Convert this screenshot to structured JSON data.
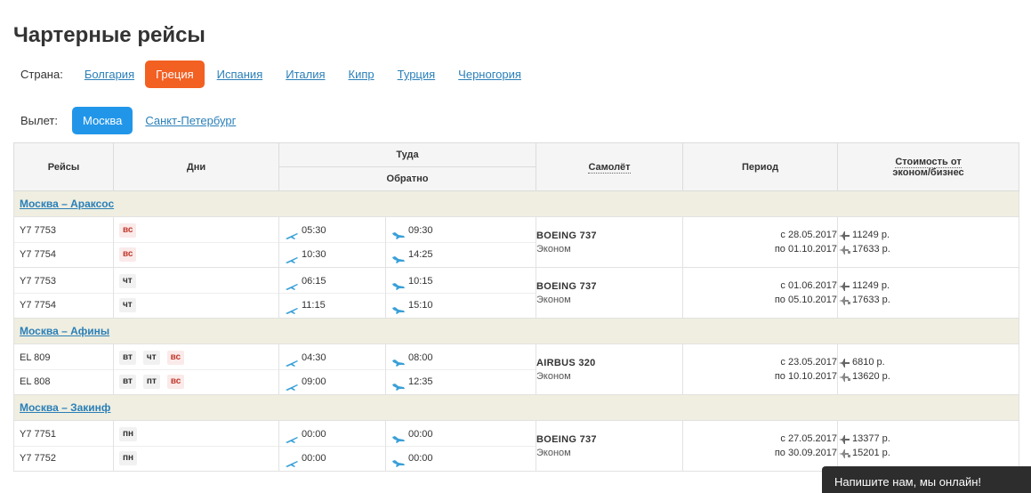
{
  "page": {
    "title": "Чартерные рейсы"
  },
  "country_filter": {
    "label": "Страна:",
    "options": [
      "Болгария",
      "Греция",
      "Испания",
      "Италия",
      "Кипр",
      "Турция",
      "Черногория"
    ],
    "selected": "Греция"
  },
  "departure_filter": {
    "label": "Вылет:",
    "options": [
      "Москва",
      "Санкт-Петербург"
    ],
    "selected": "Москва"
  },
  "table": {
    "headers": {
      "flights": "Рейсы",
      "days": "Дни",
      "there": "Туда",
      "back": "Обратно",
      "plane": "Самолёт",
      "period": "Период",
      "cost_line1": "Стоимость от",
      "cost_line2": "эконом/бизнес"
    },
    "routes": [
      {
        "name": "Москва – Араксос",
        "flights": [
          {
            "nums": [
              "Y7 7753",
              "Y7 7754"
            ],
            "days": [
              [
                "вс"
              ],
              [
                "вс"
              ]
            ],
            "there": [
              "05:30",
              "10:30"
            ],
            "back": [
              "09:30",
              "14:25"
            ],
            "plane": "BOEING 737",
            "class": "Эконом",
            "period": [
              "с 28.05.2017",
              "по 01.10.2017"
            ],
            "prices": [
              "11249 р.",
              "17633 р."
            ]
          },
          {
            "nums": [
              "Y7 7753",
              "Y7 7754"
            ],
            "days": [
              [
                "чт"
              ],
              [
                "чт"
              ]
            ],
            "there": [
              "06:15",
              "11:15"
            ],
            "back": [
              "10:15",
              "15:10"
            ],
            "plane": "BOEING 737",
            "class": "Эконом",
            "period": [
              "с 01.06.2017",
              "по 05.10.2017"
            ],
            "prices": [
              "11249 р.",
              "17633 р."
            ]
          }
        ]
      },
      {
        "name": "Москва – Афины",
        "flights": [
          {
            "nums": [
              "EL 809",
              "EL 808"
            ],
            "days": [
              [
                "вт",
                "чт",
                "вс"
              ],
              [
                "вт",
                "пт",
                "вс"
              ]
            ],
            "there": [
              "04:30",
              "09:00"
            ],
            "back": [
              "08:00",
              "12:35"
            ],
            "plane": "AIRBUS 320",
            "class": "Эконом",
            "period": [
              "с 23.05.2017",
              "по 10.10.2017"
            ],
            "prices": [
              "6810 р.",
              "13620 р."
            ]
          }
        ]
      },
      {
        "name": "Москва – Закинф",
        "flights": [
          {
            "nums": [
              "Y7 7751",
              "Y7 7752"
            ],
            "days": [
              [
                "пн"
              ],
              [
                "пн"
              ]
            ],
            "there": [
              "00:00",
              "00:00"
            ],
            "back": [
              "00:00",
              "00:00"
            ],
            "plane": "BOEING 737",
            "class": "Эконом",
            "period": [
              "с 27.05.2017",
              "по 30.09.2017"
            ],
            "prices": [
              "13377 р.",
              "15201 р."
            ]
          }
        ]
      }
    ]
  },
  "chat_widget": {
    "label": "Напишите нам, мы онлайн!"
  },
  "colors": {
    "accent_orange": "#f26022",
    "accent_blue": "#2196e9",
    "link": "#2a7fb8",
    "route_bg": "#efeee0",
    "weekend": "#c0392b"
  },
  "icons": {
    "departure": "plane-takeoff-icon",
    "return": "plane-landing-icon",
    "economy_price": "plane-icon",
    "business_price": "plane-seat-icon"
  }
}
